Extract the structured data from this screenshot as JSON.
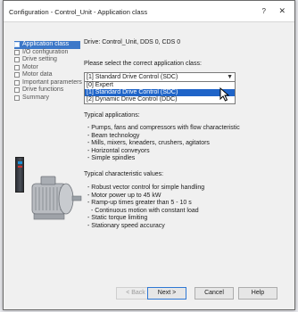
{
  "window": {
    "title": "Configuration - Control_Unit - Application class",
    "help_glyph": "?",
    "close_glyph": "✕"
  },
  "nav": {
    "items": [
      {
        "label": "Application class",
        "active": true
      },
      {
        "label": "I/O configuration",
        "active": false
      },
      {
        "label": "Drive setting",
        "active": false
      },
      {
        "label": "Motor",
        "active": false
      },
      {
        "label": "Motor data",
        "active": false
      },
      {
        "label": "Important parameters",
        "active": false
      },
      {
        "label": "Drive functions",
        "active": false
      },
      {
        "label": "Summary",
        "active": false
      }
    ]
  },
  "main": {
    "header": "Drive: Control_Unit, DDS 0, CDS 0",
    "prompt": "Please select the correct application class:",
    "select_value": "[1] Standard Drive Control (SDC)",
    "options": [
      {
        "label": "[0] Expert",
        "selected": false
      },
      {
        "label": "[1] Standard Drive Control (SDC)",
        "selected": true
      },
      {
        "label": "[2] Dynamic Drive Control (DDC)",
        "selected": false
      }
    ],
    "applications_title": "Typical applications:",
    "applications": [
      "- Pumps, fans and compressors with flow characteristic",
      "- Beam technology",
      "- Mills, mixers, kneaders, crushers, agitators",
      "- Horizontal conveyors",
      "- Simple spindles"
    ],
    "characteristics_title": "Typical characteristic values:",
    "characteristics": [
      "- Robust vector control for simple handling",
      "- Motor power up to 45 kW",
      "- Ramp-up times greater than 5 - 10 s",
      "- Continuous motion with constant load",
      "- Static torque limiting",
      "- Stationary speed accuracy"
    ]
  },
  "buttons": {
    "back": "< Back",
    "next": "Next >",
    "cancel": "Cancel",
    "help": "Help"
  },
  "colors": {
    "nav_active": "#3d78c8",
    "option_selected": "#1f64c8",
    "window_bg": "#f0f0f0"
  }
}
